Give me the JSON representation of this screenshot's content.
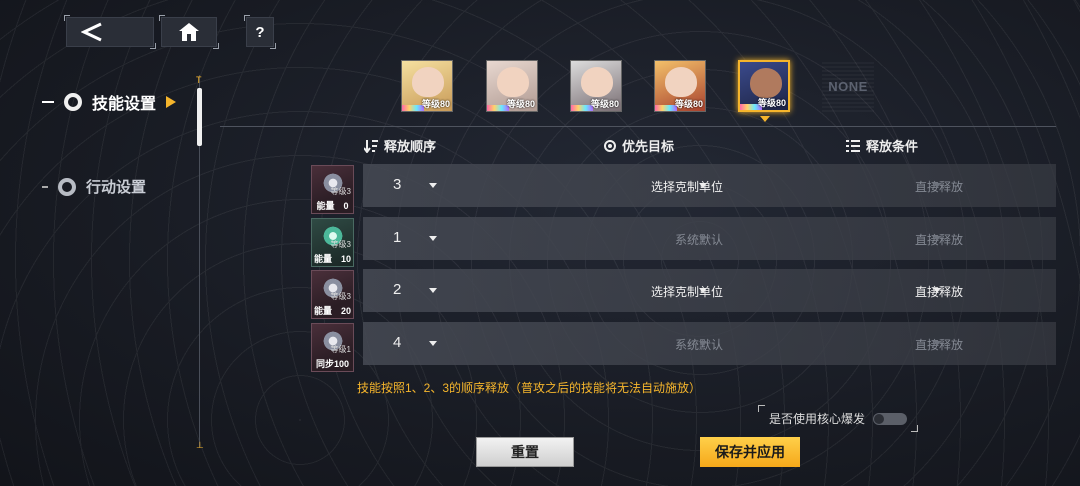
{
  "top_bar": {
    "help_label": "?"
  },
  "nav": {
    "items": [
      {
        "label": "技能设置",
        "active": true
      },
      {
        "label": "行动设置",
        "active": false
      }
    ]
  },
  "squad": {
    "characters": [
      {
        "level_label": "等级80",
        "selected": false
      },
      {
        "level_label": "等级80",
        "selected": false
      },
      {
        "level_label": "等级80",
        "selected": false
      },
      {
        "level_label": "等级80",
        "selected": false
      },
      {
        "level_label": "等级80",
        "selected": true
      }
    ],
    "empty_slot_label": "NONE"
  },
  "columns": {
    "order": "释放顺序",
    "target": "优先目标",
    "condition": "释放条件"
  },
  "skills": [
    {
      "icon": "skill-icon-1",
      "level": "等级3",
      "cost": "能量　0",
      "order": "3",
      "target": "选择克制单位",
      "target_enabled": true,
      "condition": "直接释放",
      "condition_enabled": false
    },
    {
      "icon": "skill-icon-2",
      "level": "等级3",
      "cost": "能量　10",
      "order": "1",
      "target": "系统默认",
      "target_enabled": false,
      "condition": "直接释放",
      "condition_enabled": false
    },
    {
      "icon": "skill-icon-3",
      "level": "等级3",
      "cost": "能量　20",
      "order": "2",
      "target": "选择克制单位",
      "target_enabled": true,
      "condition": "直接释放",
      "condition_enabled": true
    },
    {
      "icon": "skill-icon-4",
      "level": "等级1",
      "cost": "同步100",
      "order": "4",
      "target": "系统默认",
      "target_enabled": false,
      "condition": "直接释放",
      "condition_enabled": false
    }
  ],
  "hint": "技能按照1、2、3的顺序释放（普攻之后的技能将无法自动施放）",
  "core_burst": {
    "label": "是否使用核心爆发",
    "enabled": false
  },
  "buttons": {
    "reset": "重置",
    "save": "保存并应用"
  },
  "colors": {
    "accent": "#f5b52c",
    "row_bg": "#464a54"
  }
}
